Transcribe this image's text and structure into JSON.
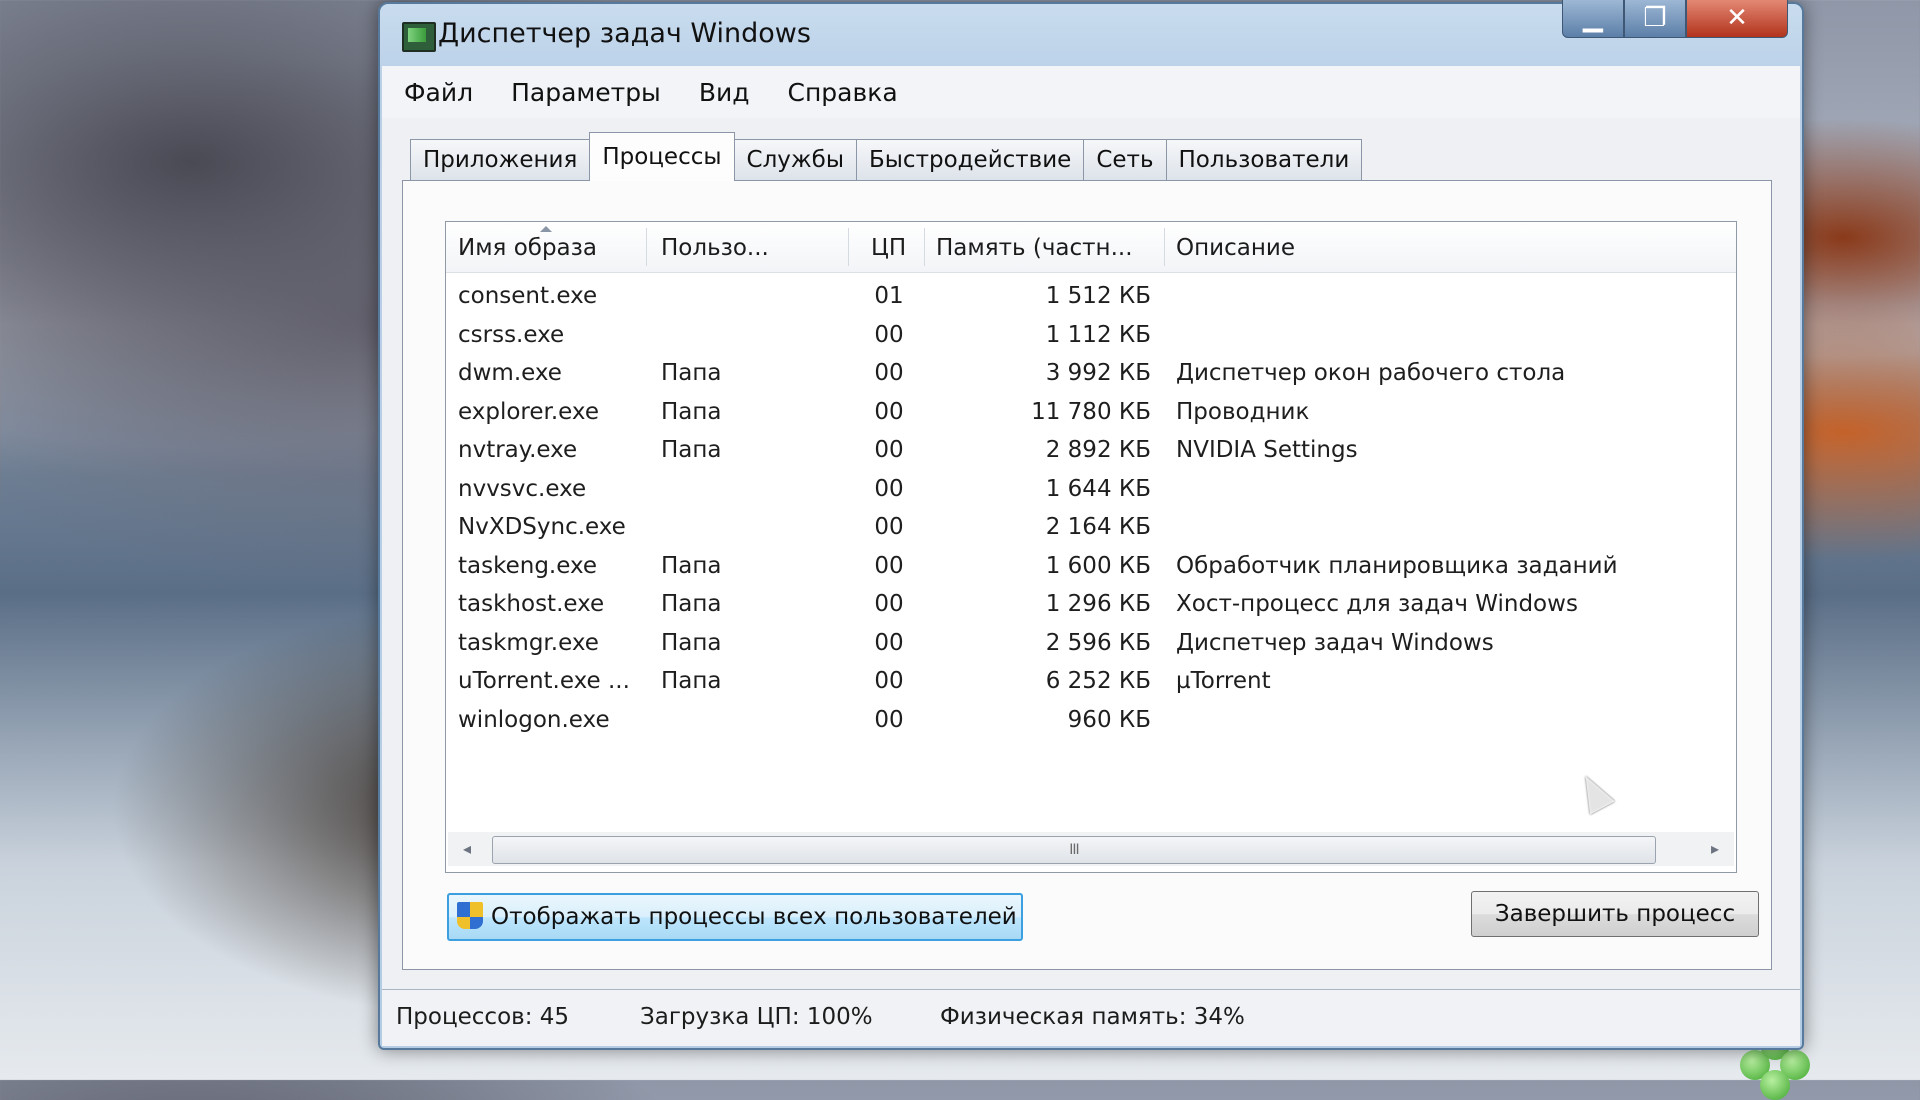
{
  "window": {
    "title": "Диспетчер задач Windows",
    "controls": {
      "minimize": "▁",
      "maximize": "❐",
      "close": "✕"
    }
  },
  "menu": [
    "Файл",
    "Параметры",
    "Вид",
    "Справка"
  ],
  "tabs": [
    {
      "label": "Приложения",
      "active": false
    },
    {
      "label": "Процессы",
      "active": true
    },
    {
      "label": "Службы",
      "active": false
    },
    {
      "label": "Быстродействие",
      "active": false
    },
    {
      "label": "Сеть",
      "active": false
    },
    {
      "label": "Пользователи",
      "active": false
    }
  ],
  "columns": {
    "name": "Имя образа",
    "user": "Пользо...",
    "cpu": "ЦП",
    "memory": "Память (частн...",
    "description": "Описание"
  },
  "processes": [
    {
      "name": "consent.exe",
      "user": "",
      "cpu": "01",
      "memory": "1 512 КБ",
      "description": ""
    },
    {
      "name": "csrss.exe",
      "user": "",
      "cpu": "00",
      "memory": "1 112 КБ",
      "description": ""
    },
    {
      "name": "dwm.exe",
      "user": "Папа",
      "cpu": "00",
      "memory": "3 992 КБ",
      "description": "Диспетчер окон рабочего стола"
    },
    {
      "name": "explorer.exe",
      "user": "Папа",
      "cpu": "00",
      "memory": "11 780 КБ",
      "description": "Проводник"
    },
    {
      "name": "nvtray.exe",
      "user": "Папа",
      "cpu": "00",
      "memory": "2 892 КБ",
      "description": "NVIDIA Settings"
    },
    {
      "name": "nvvsvc.exe",
      "user": "",
      "cpu": "00",
      "memory": "1 644 КБ",
      "description": ""
    },
    {
      "name": "NvXDSync.exe",
      "user": "",
      "cpu": "00",
      "memory": "2 164 КБ",
      "description": ""
    },
    {
      "name": "taskeng.exe",
      "user": "Папа",
      "cpu": "00",
      "memory": "1 600 КБ",
      "description": "Обработчик планировщика заданий"
    },
    {
      "name": "taskhost.exe",
      "user": "Папа",
      "cpu": "00",
      "memory": "1 296 КБ",
      "description": "Хост-процесс для задач Windows"
    },
    {
      "name": "taskmgr.exe",
      "user": "Папа",
      "cpu": "00",
      "memory": "2 596 КБ",
      "description": "Диспетчер задач Windows"
    },
    {
      "name": "uTorrent.exe ...",
      "user": "Папа",
      "cpu": "00",
      "memory": "6 252 КБ",
      "description": "µTorrent"
    },
    {
      "name": "winlogon.exe",
      "user": "",
      "cpu": "00",
      "memory": "960 КБ",
      "description": ""
    }
  ],
  "scrollbar": {
    "grip": "III"
  },
  "buttons": {
    "show_all": "Отображать процессы всех пользователей",
    "end_process": "Завершить процесс"
  },
  "status": {
    "processes": "Процессов: 45",
    "cpu_load": "Загрузка ЦП: 100%",
    "physical_memory": "Физическая память: 34%"
  },
  "icons": {
    "app": "task-manager-icon",
    "shield": "uac-shield-icon",
    "cursor": "mouse-cursor-icon"
  }
}
